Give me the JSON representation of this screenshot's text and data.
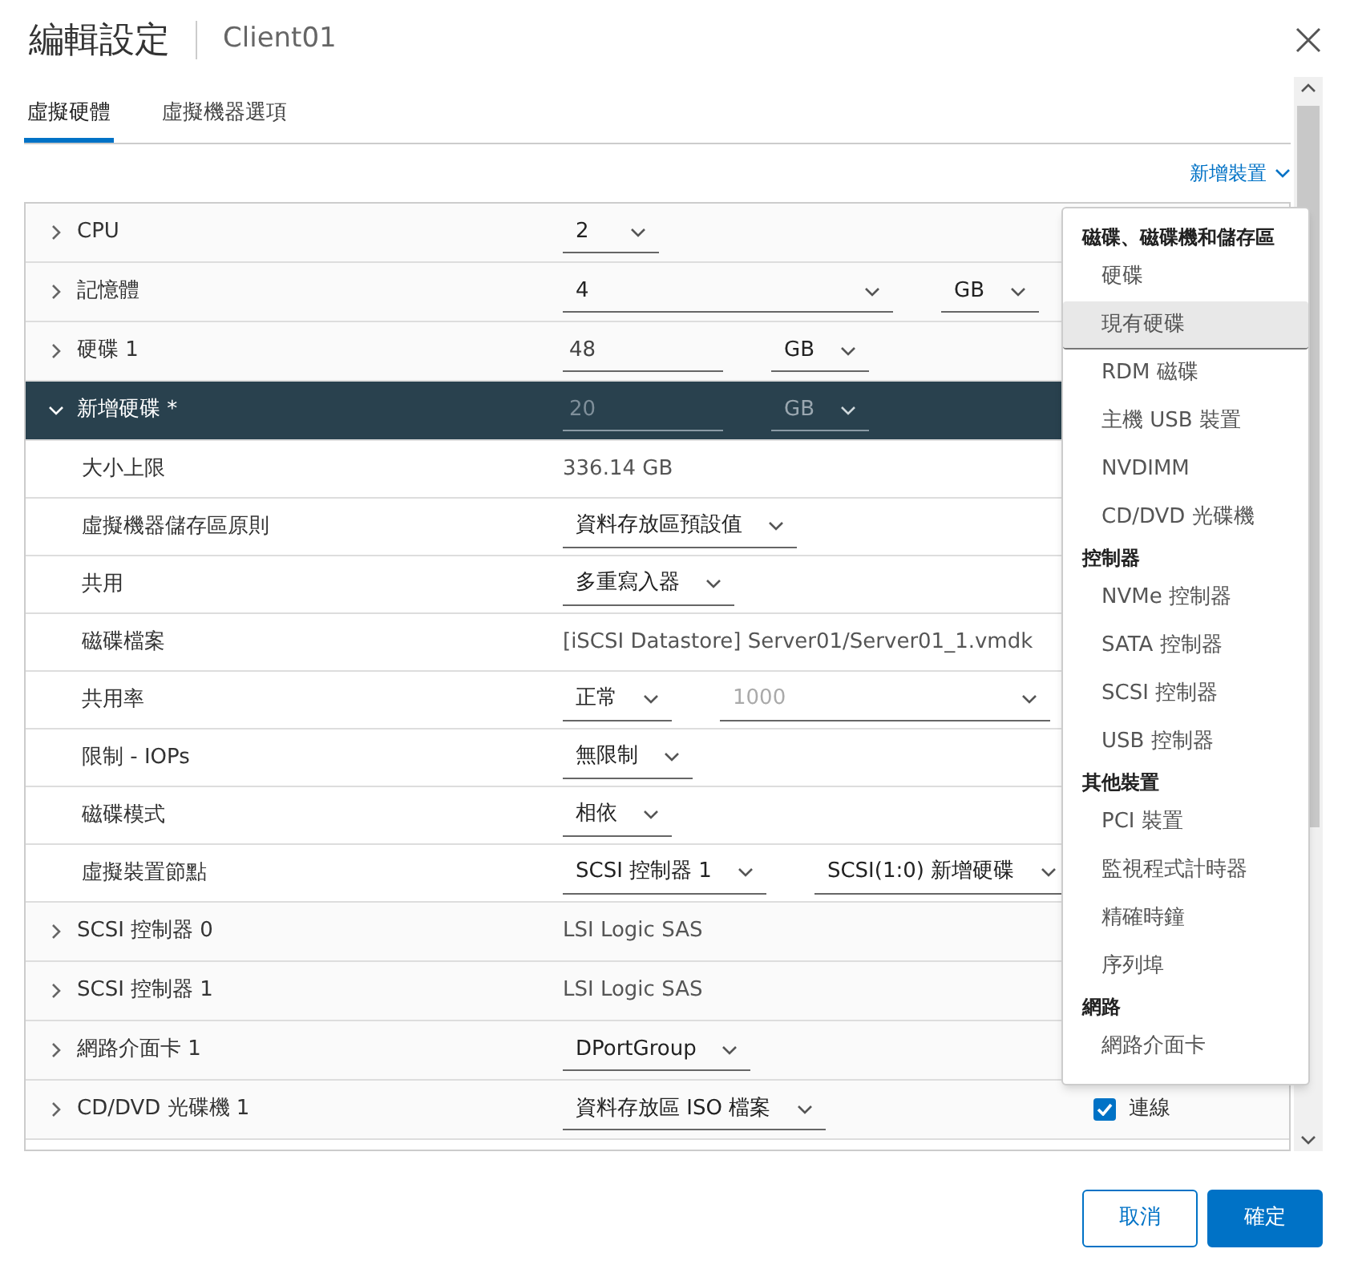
{
  "dialog": {
    "title": "編輯設定",
    "subtitle": "Client01"
  },
  "tabs": [
    {
      "label": "虛擬硬體",
      "selected": true
    },
    {
      "label": "虛擬機器選項",
      "selected": false
    }
  ],
  "add_device": {
    "label": "新增裝置"
  },
  "rows": [
    {
      "kind": "header",
      "label": "CPU",
      "expanded": false,
      "selected": false,
      "controls": [
        {
          "kind": "select",
          "value": "2"
        }
      ]
    },
    {
      "kind": "header",
      "label": "記憶體",
      "expanded": false,
      "selected": false,
      "controls": [
        {
          "kind": "select",
          "value": "4",
          "wide": true
        },
        {
          "kind": "select",
          "value": "GB"
        }
      ]
    },
    {
      "kind": "header",
      "label": "硬碟 1",
      "expanded": false,
      "selected": false,
      "controls": [
        {
          "kind": "input",
          "value": "48"
        },
        {
          "kind": "select",
          "value": "GB"
        }
      ]
    },
    {
      "kind": "header",
      "label": "新增硬碟 *",
      "expanded": true,
      "selected": true,
      "controls": [
        {
          "kind": "input",
          "value": "20"
        },
        {
          "kind": "select",
          "value": "GB"
        }
      ]
    },
    {
      "kind": "sub",
      "label": "大小上限",
      "controls": [
        {
          "kind": "text",
          "value": "336.14 GB"
        }
      ]
    },
    {
      "kind": "sub",
      "label": "虛擬機器儲存區原則",
      "controls": [
        {
          "kind": "select",
          "value": "資料存放區預設值"
        }
      ]
    },
    {
      "kind": "sub",
      "label": "共用",
      "controls": [
        {
          "kind": "select",
          "value": "多重寫入器"
        }
      ]
    },
    {
      "kind": "sub",
      "label": "磁碟檔案",
      "controls": [
        {
          "kind": "text",
          "value": "[iSCSI Datastore] Server01/Server01_1.vmdk"
        }
      ]
    },
    {
      "kind": "sub",
      "label": "共用率",
      "controls": [
        {
          "kind": "select",
          "value": "正常"
        },
        {
          "kind": "select",
          "value": "1000",
          "disabled": true,
          "wide": true
        }
      ]
    },
    {
      "kind": "sub",
      "label": "限制 - IOPs",
      "controls": [
        {
          "kind": "select",
          "value": "無限制"
        }
      ]
    },
    {
      "kind": "sub",
      "label": "磁碟模式",
      "controls": [
        {
          "kind": "select",
          "value": "相依"
        }
      ]
    },
    {
      "kind": "sub",
      "label": "虛擬裝置節點",
      "controls": [
        {
          "kind": "select",
          "value": "SCSI 控制器 1"
        },
        {
          "kind": "select",
          "value": "SCSI(1:0) 新增硬碟"
        }
      ]
    },
    {
      "kind": "header",
      "label": "SCSI 控制器 0",
      "expanded": false,
      "selected": false,
      "controls": [
        {
          "kind": "text",
          "value": "LSI Logic SAS"
        }
      ]
    },
    {
      "kind": "header",
      "label": "SCSI 控制器 1",
      "expanded": false,
      "selected": false,
      "controls": [
        {
          "kind": "text",
          "value": "LSI Logic SAS"
        }
      ]
    },
    {
      "kind": "header",
      "label": "網路介面卡 1",
      "expanded": false,
      "selected": false,
      "controls": [
        {
          "kind": "select",
          "value": "DPortGroup"
        }
      ]
    },
    {
      "kind": "header",
      "label": "CD/DVD 光碟機 1",
      "expanded": false,
      "selected": false,
      "controls": [
        {
          "kind": "select",
          "value": "資料存放區 ISO 檔案"
        },
        {
          "kind": "checkbox",
          "value": "連線",
          "checked": true
        }
      ]
    }
  ],
  "menu": {
    "sections": [
      {
        "title": "磁碟、磁碟機和儲存區",
        "items": [
          {
            "label": "硬碟",
            "selected": false
          },
          {
            "label": "現有硬碟",
            "selected": true
          },
          {
            "label": "RDM 磁碟",
            "selected": false
          },
          {
            "label": "主機 USB 裝置",
            "selected": false
          },
          {
            "label": "NVDIMM",
            "selected": false
          },
          {
            "label": "CD/DVD 光碟機",
            "selected": false
          }
        ]
      },
      {
        "title": "控制器",
        "items": [
          {
            "label": "NVMe 控制器",
            "selected": false
          },
          {
            "label": "SATA 控制器",
            "selected": false
          },
          {
            "label": "SCSI 控制器",
            "selected": false
          },
          {
            "label": "USB 控制器",
            "selected": false
          }
        ]
      },
      {
        "title": "其他裝置",
        "items": [
          {
            "label": "PCI 裝置",
            "selected": false
          },
          {
            "label": "監視程式計時器",
            "selected": false
          },
          {
            "label": "精確時鐘",
            "selected": false
          },
          {
            "label": "序列埠",
            "selected": false
          }
        ]
      },
      {
        "title": "網路",
        "items": [
          {
            "label": "網路介面卡",
            "selected": false
          }
        ]
      }
    ]
  },
  "buttons": [
    {
      "label": "取消",
      "kind": "secondary"
    },
    {
      "label": "確定",
      "kind": "primary"
    }
  ]
}
